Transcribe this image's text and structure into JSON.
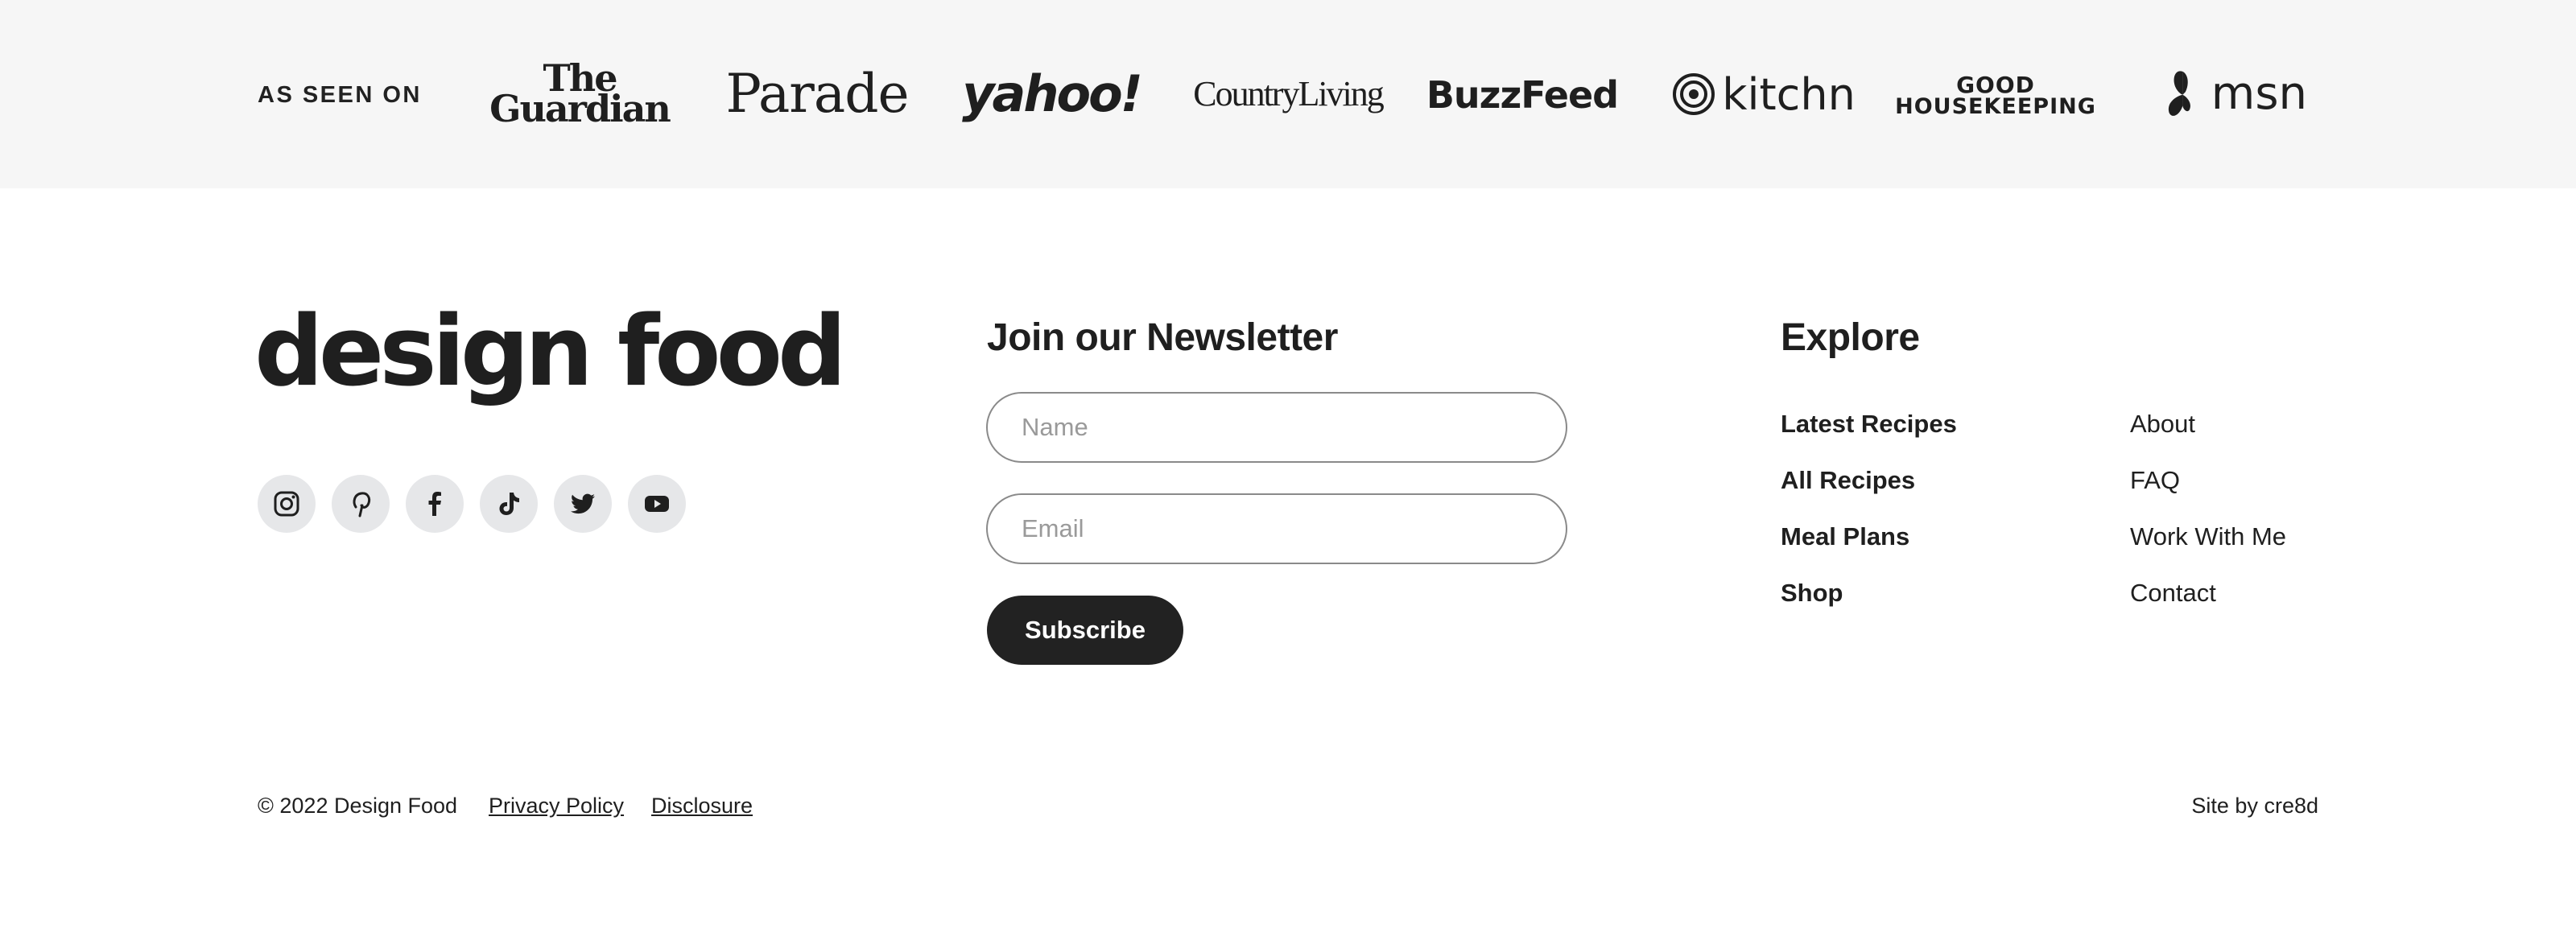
{
  "as_seen_on": {
    "label": "AS SEEN ON",
    "logos": {
      "guardian_line1": "The",
      "guardian_line2": "Guardian",
      "parade": "Parade",
      "yahoo": "yahoo!",
      "country_living": "CountryLiving",
      "buzzfeed": "BuzzFeed",
      "kitchn": "kitchn",
      "good_housekeeping_line1": "GOOD",
      "good_housekeeping_line2": "HOUSEKEEPING",
      "msn": "msn"
    }
  },
  "brand": {
    "name": "design food",
    "socials": [
      "instagram-icon",
      "pinterest-icon",
      "facebook-icon",
      "tiktok-icon",
      "twitter-icon",
      "youtube-icon"
    ]
  },
  "newsletter": {
    "title": "Join our Newsletter",
    "name_placeholder": "Name",
    "email_placeholder": "Email",
    "button_label": "Subscribe"
  },
  "explore": {
    "title": "Explore",
    "left_links": [
      "Latest Recipes",
      "All Recipes",
      "Meal Plans",
      "Shop"
    ],
    "right_links": [
      "About",
      "FAQ",
      "Work With Me",
      "Contact"
    ]
  },
  "footer": {
    "copyright": "© 2022 Design Food",
    "privacy": "Privacy Policy",
    "disclosure": "Disclosure",
    "site_by": "Site by cre8d"
  },
  "colors": {
    "band_bg": "#f6f6f6",
    "text": "#1f1f1f",
    "social_bg": "#e6e7e9",
    "button_bg": "#222222",
    "input_border": "#8a8a8a"
  }
}
